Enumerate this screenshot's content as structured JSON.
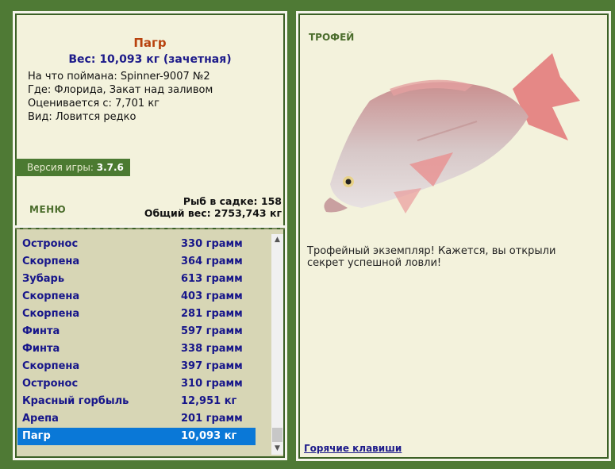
{
  "fish": {
    "name": "Пагр",
    "weight": "Вес: 10,093 кг (зачетная)",
    "bait": "На что поймана: Spinner-9007 №2",
    "place": "Где: Флорида, Закат над заливом",
    "value": "Оценивается с: 7,701 кг",
    "kind": "Вид: Ловится редко"
  },
  "version": {
    "label": "Версия игры: ",
    "number": "3.7.6"
  },
  "menu": {
    "label": "МЕНЮ"
  },
  "stats": {
    "count": "Рыб в садке: 158",
    "total": "Общий вес: 2753,743 кг"
  },
  "catch_list": [
    {
      "name": "Остронос",
      "weight": "330 грамм"
    },
    {
      "name": "Скорпена",
      "weight": "364 грамм"
    },
    {
      "name": "Зубарь",
      "weight": "613 грамм"
    },
    {
      "name": "Скорпена",
      "weight": "403 грамм"
    },
    {
      "name": "Скорпена",
      "weight": "281 грамм"
    },
    {
      "name": "Финта",
      "weight": "597 грамм"
    },
    {
      "name": "Финта",
      "weight": "338 грамм"
    },
    {
      "name": "Скорпена",
      "weight": "397 грамм"
    },
    {
      "name": "Остронос",
      "weight": "310 грамм"
    },
    {
      "name": "Красный горбыль",
      "weight": "12,951 кг"
    },
    {
      "name": "Арепа",
      "weight": "201 грамм"
    },
    {
      "name": "Пагр",
      "weight": "10,093 кг",
      "selected": true
    }
  ],
  "trophy": {
    "label": "ТРОФЕЙ",
    "text": "Трофейный экземпляр! Кажется, вы открыли секрет успешной ловли!"
  },
  "hotkeys": {
    "label": "Горячие клавиши"
  },
  "icons": {
    "scroll_up": "scroll-up-arrow",
    "scroll_down": "scroll-down-arrow"
  },
  "colors": {
    "background": "#4f7a35",
    "panel": "#f3f2dc",
    "selection": "#0a78d7",
    "list_text": "#17168a",
    "fish_name": "#b8420e"
  }
}
